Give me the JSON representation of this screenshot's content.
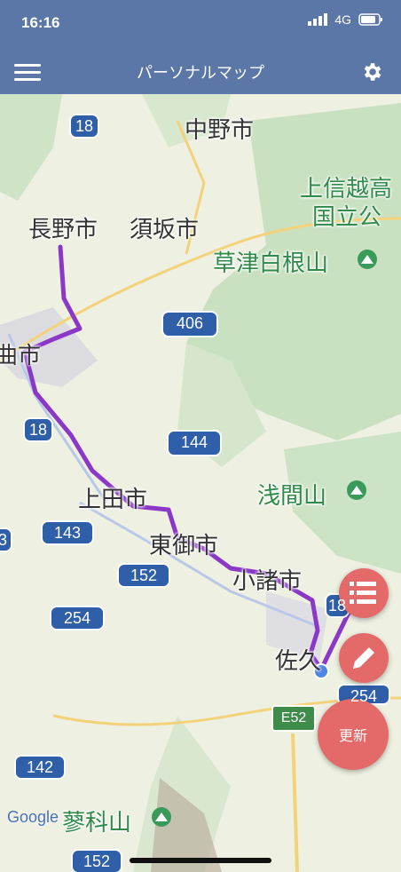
{
  "status": {
    "time": "16:16",
    "network": "4G"
  },
  "navbar": {
    "title": "パーソナルマップ"
  },
  "map": {
    "places": {
      "nagano": "長野市",
      "suzaka": "須坂市",
      "nakano": "中野市",
      "chikuma": "曲市",
      "ueda": "上田市",
      "tomi": "東御市",
      "komoro": "小諸市",
      "saku": "佐久",
      "jyoshinetsu_1": "上信越高",
      "jyoshinetsu_2": "国立公",
      "kusatsu": "草津白根山",
      "asama": "浅間山",
      "tateshina": "蓼科山"
    },
    "routes": {
      "r18_top": "18",
      "r406": "406",
      "r18_mid": "18",
      "r144": "144",
      "r143": "143",
      "r152": "152",
      "r254": "254",
      "r142": "142",
      "r152_bottom": "152",
      "r254_right": "254",
      "r18_right": "18",
      "r3_left": "3",
      "e52": "E52"
    },
    "google": "Google"
  },
  "buttons": {
    "refresh": "更新"
  }
}
